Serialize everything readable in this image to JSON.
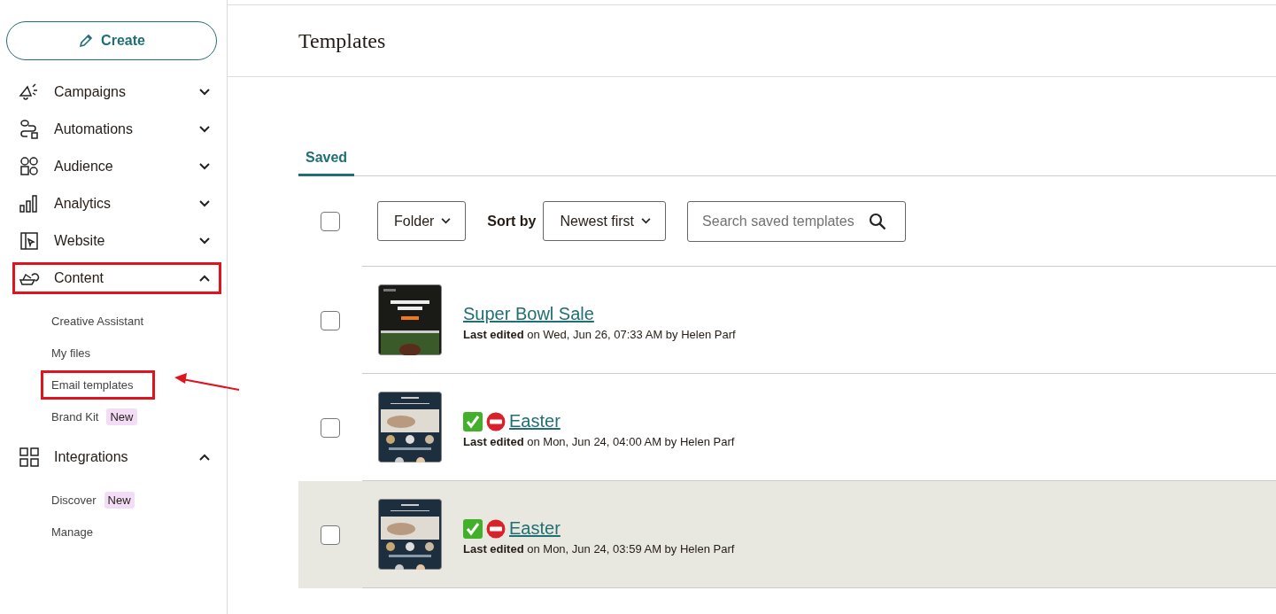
{
  "sidebar": {
    "create_button": "Create",
    "items": [
      {
        "label": "Campaigns",
        "expanded": false,
        "highlighted": false
      },
      {
        "label": "Automations",
        "expanded": false,
        "highlighted": false
      },
      {
        "label": "Audience",
        "expanded": false,
        "highlighted": false
      },
      {
        "label": "Analytics",
        "expanded": false,
        "highlighted": false
      },
      {
        "label": "Website",
        "expanded": false,
        "highlighted": false
      },
      {
        "label": "Content",
        "expanded": true,
        "highlighted": true,
        "children": [
          {
            "label": "Creative Assistant",
            "highlighted": false
          },
          {
            "label": "My files",
            "highlighted": false
          },
          {
            "label": "Email templates",
            "highlighted": true
          },
          {
            "label": "Brand Kit",
            "highlighted": false,
            "badge": "New"
          }
        ]
      },
      {
        "label": "Integrations",
        "expanded": true,
        "highlighted": false,
        "children": [
          {
            "label": "Discover",
            "highlighted": false,
            "badge": "New"
          },
          {
            "label": "Manage",
            "highlighted": false
          }
        ]
      }
    ]
  },
  "page": {
    "title": "Templates"
  },
  "tabs": [
    {
      "label": "Saved",
      "selected": true
    }
  ],
  "toolbar": {
    "select_all": {
      "checked": false
    },
    "folder": "Folder",
    "sort_label": "Sort by",
    "sort_value": "Newest first",
    "search": {
      "placeholder": "Search saved templates"
    }
  },
  "templates": [
    {
      "name": "Super Bowl Sale",
      "edited_label": "Last edited",
      "edited_text": "on Wed, Jun 26, 07:33 AM by Helen Parf",
      "kind": "sale",
      "checked": false,
      "hovered": false
    },
    {
      "name": "Easter",
      "status_icons": [
        {
          "kind": "check"
        },
        {
          "kind": "no-entry"
        }
      ],
      "edited_label": "Last edited",
      "edited_text": "on Mon, Jun 24, 04:00 AM by Helen Parf",
      "kind": "easter",
      "checked": false,
      "hovered": false
    },
    {
      "name": "Easter",
      "status_icons": [
        {
          "kind": "check"
        },
        {
          "kind": "no-entry"
        }
      ],
      "edited_label": "Last edited",
      "edited_text": "on Mon, Jun 24, 03:59 AM by Helen Parf",
      "kind": "easter",
      "checked": false,
      "hovered": true
    }
  ]
}
